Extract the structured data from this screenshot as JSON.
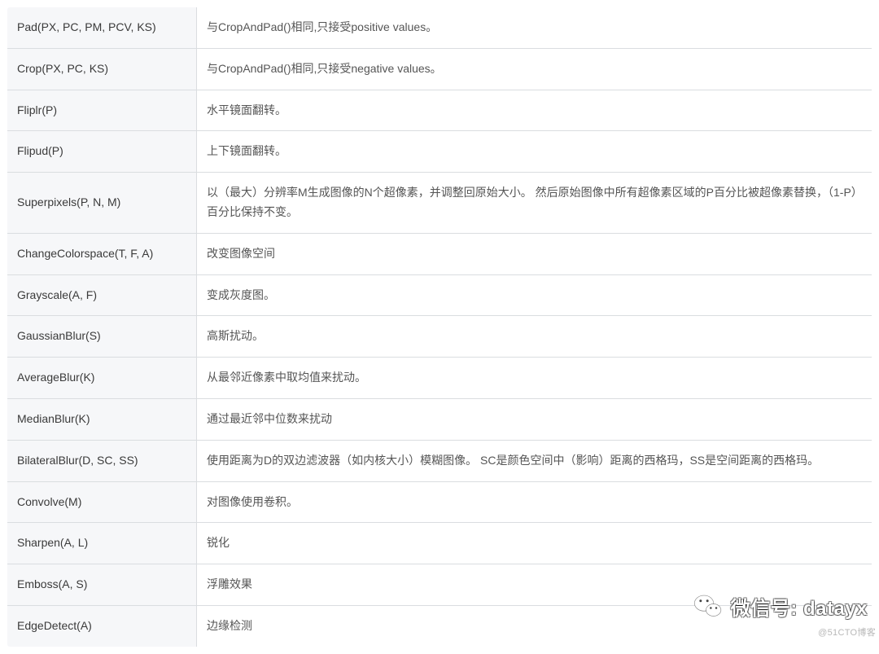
{
  "table": {
    "rows": [
      {
        "func": "Pad(PX, PC, PM, PCV, KS)",
        "desc": "与CropAndPad()相同,只接受positive values。"
      },
      {
        "func": "Crop(PX, PC, KS)",
        "desc": "与CropAndPad()相同,只接受negative values。"
      },
      {
        "func": "Fliplr(P)",
        "desc": "水平镜面翻转。"
      },
      {
        "func": "Flipud(P)",
        "desc": "上下镜面翻转。"
      },
      {
        "func": "Superpixels(P, N, M)",
        "desc": "以（最大）分辨率M生成图像的N个超像素，并调整回原始大小。 然后原始图像中所有超像素区域的P百分比被超像素替换，（1-P）百分比保持不变。"
      },
      {
        "func": "ChangeColorspace(T, F, A)",
        "desc": "改变图像空间"
      },
      {
        "func": "Grayscale(A, F)",
        "desc": "变成灰度图。"
      },
      {
        "func": "GaussianBlur(S)",
        "desc": "高斯扰动。"
      },
      {
        "func": "AverageBlur(K)",
        "desc": "从最邻近像素中取均值来扰动。"
      },
      {
        "func": "MedianBlur(K)",
        "desc": "通过最近邻中位数来扰动"
      },
      {
        "func": "BilateralBlur(D, SC, SS)",
        "desc": "使用距离为D的双边滤波器（如内核大小）模糊图像。 SC是颜色空间中（影响）距离的西格玛，SS是空间距离的西格玛。"
      },
      {
        "func": "Convolve(M)",
        "desc": "对图像使用卷积。"
      },
      {
        "func": "Sharpen(A, L)",
        "desc": "锐化"
      },
      {
        "func": "Emboss(A, S)",
        "desc": "浮雕效果"
      },
      {
        "func": "EdgeDetect(A)",
        "desc": "边缘检测"
      }
    ]
  },
  "watermark": {
    "text": "微信号: datayx",
    "icon_name": "wechat-icon"
  },
  "credit": "@51CTO博客"
}
